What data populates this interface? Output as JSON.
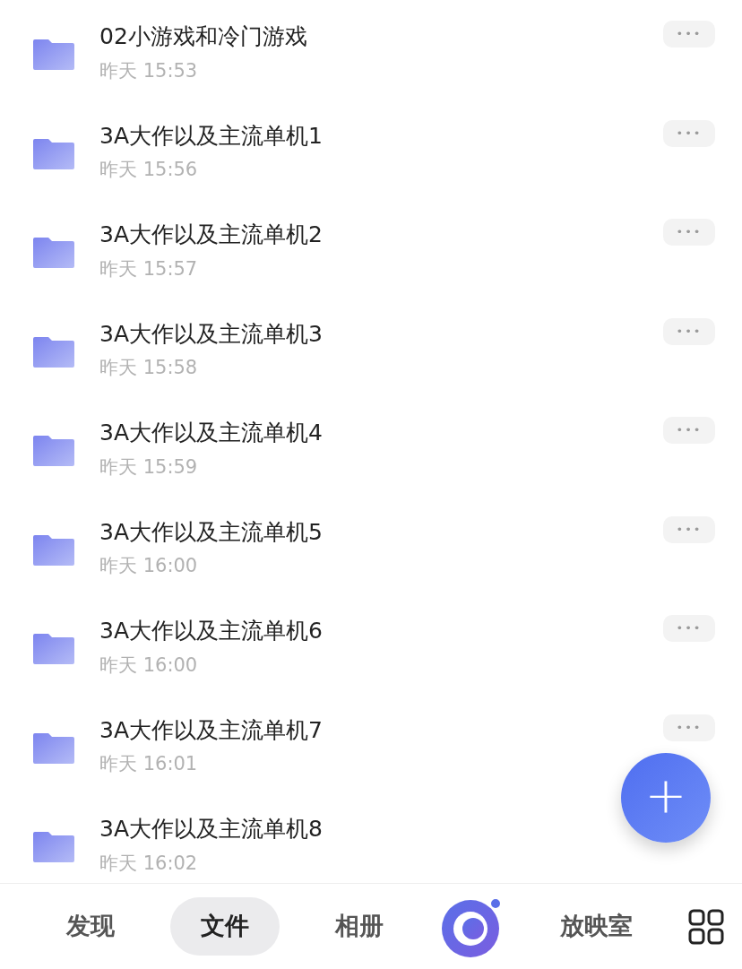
{
  "files": [
    {
      "name": "02小游戏和冷门游戏",
      "date": "昨天 15:53",
      "more_button": true
    },
    {
      "name": "3A大作以及主流单机1",
      "date": "昨天 15:56",
      "more_button": true
    },
    {
      "name": "3A大作以及主流单机2",
      "date": "昨天 15:57",
      "more_button": true
    },
    {
      "name": "3A大作以及主流单机3",
      "date": "昨天 15:58",
      "more_button": true
    },
    {
      "name": "3A大作以及主流单机4",
      "date": "昨天 15:59",
      "more_button": true
    },
    {
      "name": "3A大作以及主流单机5",
      "date": "昨天 16:00",
      "more_button": true
    },
    {
      "name": "3A大作以及主流单机6",
      "date": "昨天 16:00",
      "more_button": true
    },
    {
      "name": "3A大作以及主流单机7",
      "date": "昨天 16:01",
      "more_button": true
    },
    {
      "name": "3A大作以及主流单机8",
      "date": "昨天 16:02",
      "more_button": false
    }
  ],
  "more_label": "•••",
  "fab": "+",
  "bottom_nav": [
    {
      "kind": "tab",
      "label": "发现",
      "selected": false
    },
    {
      "kind": "tab",
      "label": "文件",
      "selected": true
    },
    {
      "kind": "tab",
      "label": "相册",
      "selected": false
    },
    {
      "kind": "logo"
    },
    {
      "kind": "tab",
      "label": "放映室",
      "selected": false
    },
    {
      "kind": "grid"
    }
  ]
}
